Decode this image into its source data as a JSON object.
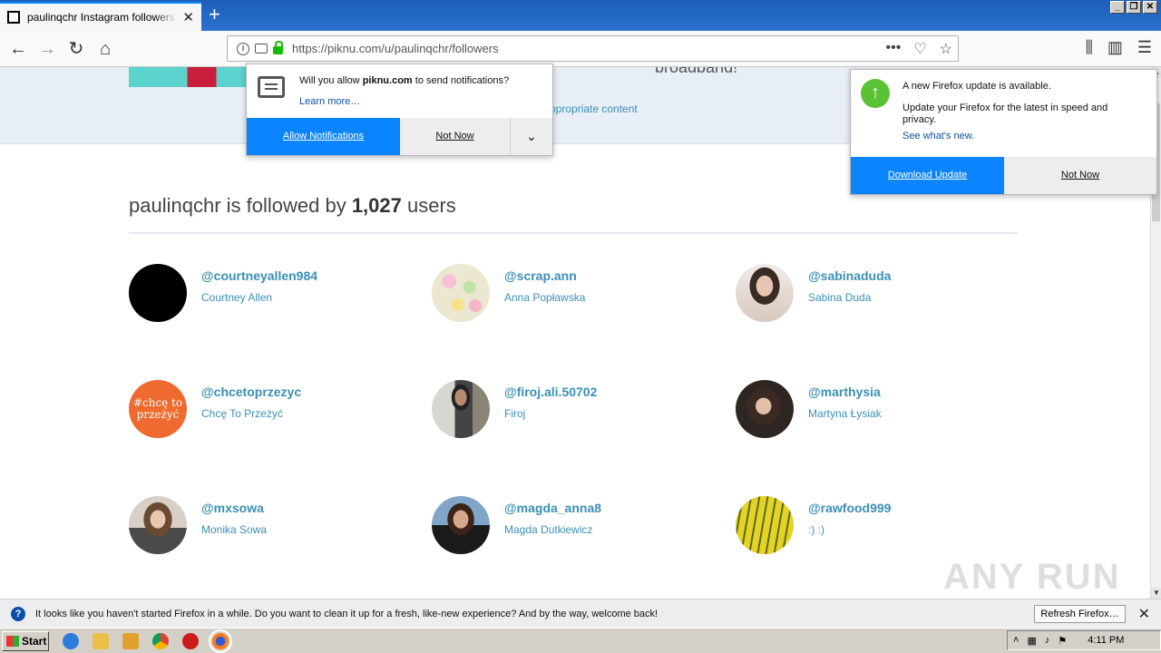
{
  "browser": {
    "tab_title": "paulinqchr Instagram followers - Pi",
    "url": "https://piknu.com/u/paulinqchr/followers"
  },
  "page": {
    "banner_text": "broadband!",
    "inappropriate_link": "ppropriate content",
    "title_prefix": "paulinqchr is followed by ",
    "title_count": "1,027",
    "title_suffix": " users",
    "followers": [
      {
        "handle": "@courtneyallen984",
        "name": "Courtney Allen",
        "avatar_color": "#000000"
      },
      {
        "handle": "@scrap.ann",
        "name": "Anna Popławska",
        "avatar_color": "#e8e4c8"
      },
      {
        "handle": "@sabinaduda",
        "name": "Sabina Duda",
        "avatar_color": "#d9c3b5"
      },
      {
        "handle": "@chcetoprzezyc",
        "name": "Chcę To Przeżyć",
        "avatar_color": "#ee6a2e",
        "avatar_text": "#chcę to przeżyć"
      },
      {
        "handle": "@firoj.ali.50702",
        "name": "Firoj",
        "avatar_color": "#5d5a52"
      },
      {
        "handle": "@marthysia",
        "name": "Martyna Łysiak",
        "avatar_color": "#4a3a34"
      },
      {
        "handle": "@mxsowa",
        "name": "Monika Sowa",
        "avatar_color": "#8a7060"
      },
      {
        "handle": "@magda_anna8",
        "name": "Magda Dutkiewicz",
        "avatar_color": "#6a8aa8"
      },
      {
        "handle": "@rawfood999",
        "name": ":) :)",
        "avatar_color": "#d6c82c"
      }
    ],
    "watermark": "ANY RUN"
  },
  "notification_popup": {
    "msg_prefix": "Will you allow ",
    "msg_domain": "piknu.com",
    "msg_suffix": " to send notifications?",
    "learn_more": "Learn more…",
    "allow_label": "Allow Notifications",
    "not_now_label": "Not Now"
  },
  "update_popup": {
    "title": "A new Firefox update is available.",
    "desc": "Update your Firefox for the latest in speed and privacy.",
    "whats_new": "See what's new.",
    "download_label": "Download Update",
    "not_now_label": "Not Now"
  },
  "refresh_bar": {
    "message": "It looks like you haven't started Firefox in a while. Do you want to clean it up for a fresh, like-new experience? And by the way, welcome back!",
    "button_label": "Refresh Firefox…"
  },
  "taskbar": {
    "start_label": "Start",
    "clock": "4:11 PM"
  },
  "colors": {
    "accent": "#0a84ff",
    "link": "#3a8fb7",
    "update_green": "#5bc236"
  }
}
